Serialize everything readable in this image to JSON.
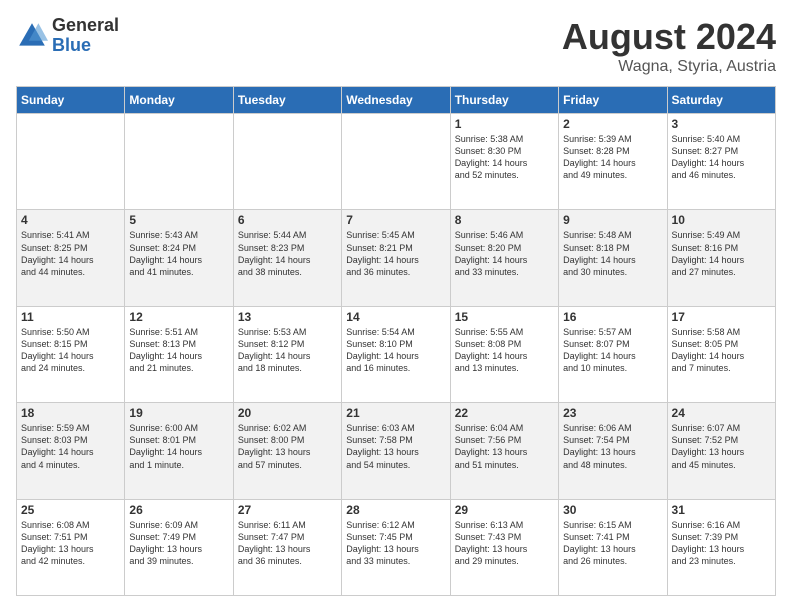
{
  "header": {
    "logo_general": "General",
    "logo_blue": "Blue",
    "month_title": "August 2024",
    "location": "Wagna, Styria, Austria"
  },
  "days_of_week": [
    "Sunday",
    "Monday",
    "Tuesday",
    "Wednesday",
    "Thursday",
    "Friday",
    "Saturday"
  ],
  "weeks": [
    [
      {
        "day": "",
        "info": ""
      },
      {
        "day": "",
        "info": ""
      },
      {
        "day": "",
        "info": ""
      },
      {
        "day": "",
        "info": ""
      },
      {
        "day": "1",
        "info": "Sunrise: 5:38 AM\nSunset: 8:30 PM\nDaylight: 14 hours\nand 52 minutes."
      },
      {
        "day": "2",
        "info": "Sunrise: 5:39 AM\nSunset: 8:28 PM\nDaylight: 14 hours\nand 49 minutes."
      },
      {
        "day": "3",
        "info": "Sunrise: 5:40 AM\nSunset: 8:27 PM\nDaylight: 14 hours\nand 46 minutes."
      }
    ],
    [
      {
        "day": "4",
        "info": "Sunrise: 5:41 AM\nSunset: 8:25 PM\nDaylight: 14 hours\nand 44 minutes."
      },
      {
        "day": "5",
        "info": "Sunrise: 5:43 AM\nSunset: 8:24 PM\nDaylight: 14 hours\nand 41 minutes."
      },
      {
        "day": "6",
        "info": "Sunrise: 5:44 AM\nSunset: 8:23 PM\nDaylight: 14 hours\nand 38 minutes."
      },
      {
        "day": "7",
        "info": "Sunrise: 5:45 AM\nSunset: 8:21 PM\nDaylight: 14 hours\nand 36 minutes."
      },
      {
        "day": "8",
        "info": "Sunrise: 5:46 AM\nSunset: 8:20 PM\nDaylight: 14 hours\nand 33 minutes."
      },
      {
        "day": "9",
        "info": "Sunrise: 5:48 AM\nSunset: 8:18 PM\nDaylight: 14 hours\nand 30 minutes."
      },
      {
        "day": "10",
        "info": "Sunrise: 5:49 AM\nSunset: 8:16 PM\nDaylight: 14 hours\nand 27 minutes."
      }
    ],
    [
      {
        "day": "11",
        "info": "Sunrise: 5:50 AM\nSunset: 8:15 PM\nDaylight: 14 hours\nand 24 minutes."
      },
      {
        "day": "12",
        "info": "Sunrise: 5:51 AM\nSunset: 8:13 PM\nDaylight: 14 hours\nand 21 minutes."
      },
      {
        "day": "13",
        "info": "Sunrise: 5:53 AM\nSunset: 8:12 PM\nDaylight: 14 hours\nand 18 minutes."
      },
      {
        "day": "14",
        "info": "Sunrise: 5:54 AM\nSunset: 8:10 PM\nDaylight: 14 hours\nand 16 minutes."
      },
      {
        "day": "15",
        "info": "Sunrise: 5:55 AM\nSunset: 8:08 PM\nDaylight: 14 hours\nand 13 minutes."
      },
      {
        "day": "16",
        "info": "Sunrise: 5:57 AM\nSunset: 8:07 PM\nDaylight: 14 hours\nand 10 minutes."
      },
      {
        "day": "17",
        "info": "Sunrise: 5:58 AM\nSunset: 8:05 PM\nDaylight: 14 hours\nand 7 minutes."
      }
    ],
    [
      {
        "day": "18",
        "info": "Sunrise: 5:59 AM\nSunset: 8:03 PM\nDaylight: 14 hours\nand 4 minutes."
      },
      {
        "day": "19",
        "info": "Sunrise: 6:00 AM\nSunset: 8:01 PM\nDaylight: 14 hours\nand 1 minute."
      },
      {
        "day": "20",
        "info": "Sunrise: 6:02 AM\nSunset: 8:00 PM\nDaylight: 13 hours\nand 57 minutes."
      },
      {
        "day": "21",
        "info": "Sunrise: 6:03 AM\nSunset: 7:58 PM\nDaylight: 13 hours\nand 54 minutes."
      },
      {
        "day": "22",
        "info": "Sunrise: 6:04 AM\nSunset: 7:56 PM\nDaylight: 13 hours\nand 51 minutes."
      },
      {
        "day": "23",
        "info": "Sunrise: 6:06 AM\nSunset: 7:54 PM\nDaylight: 13 hours\nand 48 minutes."
      },
      {
        "day": "24",
        "info": "Sunrise: 6:07 AM\nSunset: 7:52 PM\nDaylight: 13 hours\nand 45 minutes."
      }
    ],
    [
      {
        "day": "25",
        "info": "Sunrise: 6:08 AM\nSunset: 7:51 PM\nDaylight: 13 hours\nand 42 minutes."
      },
      {
        "day": "26",
        "info": "Sunrise: 6:09 AM\nSunset: 7:49 PM\nDaylight: 13 hours\nand 39 minutes."
      },
      {
        "day": "27",
        "info": "Sunrise: 6:11 AM\nSunset: 7:47 PM\nDaylight: 13 hours\nand 36 minutes."
      },
      {
        "day": "28",
        "info": "Sunrise: 6:12 AM\nSunset: 7:45 PM\nDaylight: 13 hours\nand 33 minutes."
      },
      {
        "day": "29",
        "info": "Sunrise: 6:13 AM\nSunset: 7:43 PM\nDaylight: 13 hours\nand 29 minutes."
      },
      {
        "day": "30",
        "info": "Sunrise: 6:15 AM\nSunset: 7:41 PM\nDaylight: 13 hours\nand 26 minutes."
      },
      {
        "day": "31",
        "info": "Sunrise: 6:16 AM\nSunset: 7:39 PM\nDaylight: 13 hours\nand 23 minutes."
      }
    ]
  ]
}
